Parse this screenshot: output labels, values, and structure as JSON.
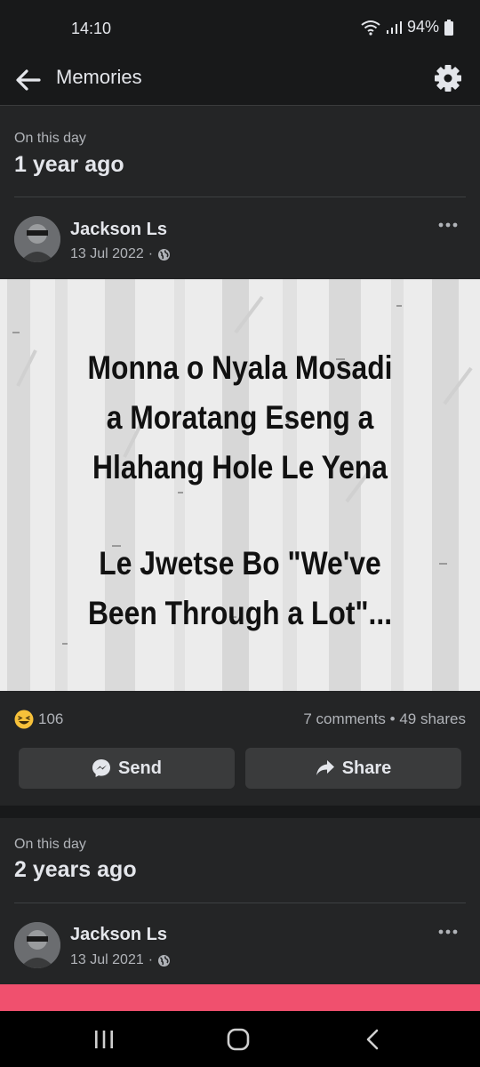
{
  "status": {
    "time": "14:10",
    "battery": "94%"
  },
  "header": {
    "title": "Memories"
  },
  "memories": [
    {
      "subtitle": "On this day",
      "heading": "1 year ago",
      "author": "Jackson Ls",
      "date": "13 Jul 2022",
      "image_text_lines": [
        "Monna o Nyala Mosadi",
        "a Moratang Eseng a",
        "Hlahang Hole Le Yena",
        "",
        "Le Jwetse Bo \"We've",
        "Been Through a Lot\"..."
      ],
      "reaction_count": "106",
      "engagement": "7 comments • 49 shares",
      "send_label": "Send",
      "share_label": "Share"
    },
    {
      "subtitle": "On this day",
      "heading": "2 years ago",
      "author": "Jackson Ls",
      "date": "13 Jul 2021"
    }
  ],
  "icons": {
    "back": "arrow-left-icon",
    "settings": "gear-icon",
    "more": "more-horizontal-icon",
    "privacy": "globe-icon",
    "reaction": "laughing-emoji-icon",
    "send": "messenger-icon",
    "share": "share-arrow-icon"
  },
  "colors": {
    "background": "#242526",
    "accent_bar": "#f0506e",
    "text": "#e4e6eb",
    "muted": "#b0b3b8"
  }
}
